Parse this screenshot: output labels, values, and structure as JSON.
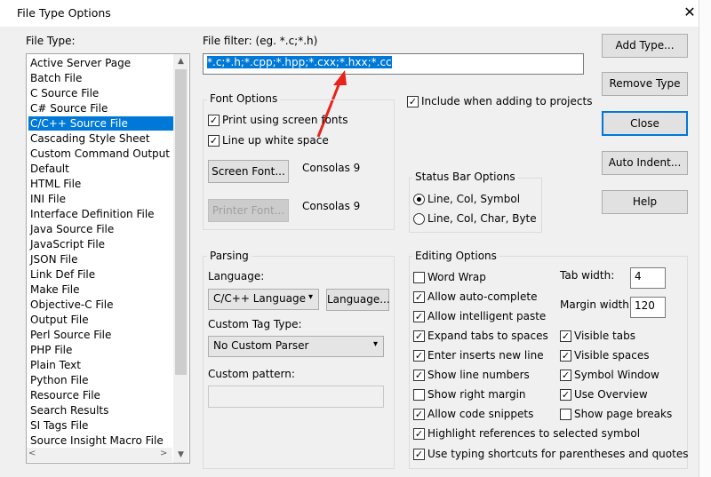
{
  "window": {
    "title": "File Type Options",
    "close_glyph": "✕"
  },
  "file_type": {
    "label": "File Type:",
    "selected_index": 4,
    "items": [
      "Active Server Page",
      "Batch File",
      "C Source File",
      "C# Source File",
      "C/C++ Source File",
      "Cascading Style Sheet",
      "Custom Command Output",
      "Default",
      "HTML File",
      "INI File",
      "Interface Definition File",
      "Java Source File",
      "JavaScript File",
      "JSON File",
      "Link Def File",
      "Make File",
      "Objective-C File",
      "Output File",
      "Perl Source File",
      "PHP File",
      "Plain Text",
      "Python File",
      "Resource File",
      "Search Results",
      "SI Tags File",
      "Source Insight Macro File"
    ]
  },
  "file_filter": {
    "label": "File filter: (eg. *.c;*.h)",
    "value": "*.c;*.h;*.cpp;*.hpp;*.cxx;*.hxx;*.cc"
  },
  "font_options": {
    "title": "Font Options",
    "print_screen_fonts": "Print using screen fonts",
    "line_up_white": "Line up white space",
    "screen_font_button": "Screen Font...",
    "screen_font_value": "Consolas 9",
    "printer_font_button": "Printer Font...",
    "printer_font_value": "Consolas 9"
  },
  "include_projects": "Include when adding to projects",
  "status_bar": {
    "title": "Status Bar Options",
    "opt1": "Line, Col, Symbol",
    "opt2": "Line, Col, Char, Byte"
  },
  "parsing": {
    "title": "Parsing",
    "language_label": "Language:",
    "language_value": "C/C++ Language",
    "language_button": "Language...",
    "custom_tag_label": "Custom Tag Type:",
    "custom_tag_value": "No Custom Parser",
    "custom_pattern_label": "Custom pattern:",
    "custom_pattern_value": ""
  },
  "editing": {
    "title": "Editing Options",
    "word_wrap": "Word Wrap",
    "auto_complete": "Allow auto-complete",
    "intelligent_paste": "Allow intelligent paste",
    "expand_tabs": "Expand tabs to spaces",
    "inserts_new_line": "Enter inserts new line",
    "show_line_numbers": "Show line numbers",
    "show_right_margin": "Show right margin",
    "code_snippets": "Allow code snippets",
    "highlight_refs": "Highlight references to selected symbol",
    "typing_shortcuts": "Use typing shortcuts for parentheses and quotes",
    "tab_width_label": "Tab width:",
    "tab_width_value": "4",
    "margin_width_label": "Margin width:",
    "margin_width_value": "120",
    "visible_tabs": "Visible tabs",
    "visible_spaces": "Visible spaces",
    "symbol_window": "Symbol Window",
    "use_overview": "Use Overview",
    "show_page_breaks": "Show page breaks"
  },
  "buttons": {
    "add_type": "Add Type...",
    "remove_type": "Remove Type",
    "close": "Close",
    "auto_indent": "Auto Indent...",
    "help": "Help"
  },
  "colors": {
    "selection": "#0078d7",
    "annotation_arrow": "#e8231b",
    "dialog_bg": "#f0f0f0"
  }
}
